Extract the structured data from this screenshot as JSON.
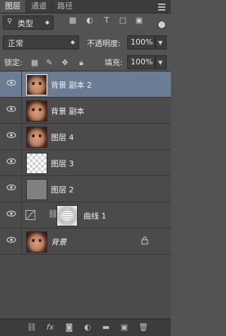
{
  "tabs": [
    {
      "label": "图层",
      "active": true
    },
    {
      "label": "通道",
      "active": false
    },
    {
      "label": "路径",
      "active": false
    }
  ],
  "filter": {
    "kind_label": "类型",
    "icons": [
      "image-filter-icon",
      "adjustment-filter-icon",
      "type-filter-icon",
      "shape-filter-icon",
      "smart-object-filter-icon"
    ]
  },
  "blend": {
    "mode": "正常",
    "opacity_label": "不透明度:",
    "opacity_value": "100%"
  },
  "locks": {
    "label": "锁定:",
    "fill_label": "填充:",
    "fill_value": "100%"
  },
  "layers": [
    {
      "name": "背景 副本 2",
      "thumb": "face",
      "selected": true
    },
    {
      "name": "背景 副本",
      "thumb": "face",
      "selected": false
    },
    {
      "name": "图层 4",
      "thumb": "face",
      "selected": false
    },
    {
      "name": "图层 3",
      "thumb": "trans",
      "selected": false
    },
    {
      "name": "图层 2",
      "thumb": "gray",
      "selected": false
    },
    {
      "name": "曲线 1",
      "thumb": "curves",
      "selected": false
    },
    {
      "name": "背景",
      "thumb": "face",
      "selected": false,
      "locked": true
    }
  ],
  "footer_icons": [
    "link-icon",
    "fx-icon",
    "mask-icon",
    "adjustment-icon",
    "folder-icon",
    "new-layer-icon",
    "trash-icon"
  ],
  "footer": {
    "fx": "fx"
  }
}
